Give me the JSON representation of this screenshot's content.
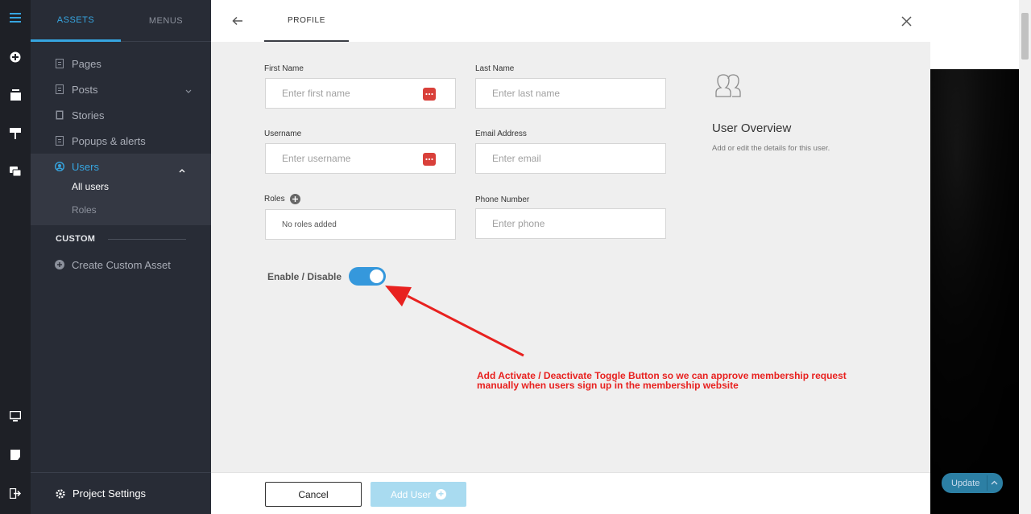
{
  "sidebar": {
    "tabs": [
      {
        "label": "ASSETS"
      },
      {
        "label": "MENUS"
      }
    ],
    "items": [
      {
        "label": "Pages"
      },
      {
        "label": "Posts"
      },
      {
        "label": "Stories"
      },
      {
        "label": "Popups & alerts"
      },
      {
        "label": "Users"
      }
    ],
    "users_sub": [
      "All users",
      "Roles"
    ],
    "custom_heading": "CUSTOM",
    "create_custom": "Create Custom Asset",
    "project_settings": "Project Settings"
  },
  "panel": {
    "tab_label": "PROFILE",
    "fields": {
      "first_name": {
        "label": "First Name",
        "placeholder": "Enter first name"
      },
      "last_name": {
        "label": "Last Name",
        "placeholder": "Enter last name"
      },
      "username": {
        "label": "Username",
        "placeholder": "Enter username"
      },
      "email": {
        "label": "Email Address",
        "placeholder": "Enter email"
      },
      "roles": {
        "label": "Roles",
        "value": "No roles added"
      },
      "phone": {
        "label": "Phone Number",
        "placeholder": "Enter phone"
      }
    },
    "overview": {
      "title": "User Overview",
      "subtitle": "Add or edit the details for this user."
    },
    "toggle": {
      "label": "Enable / Disable",
      "enabled": true
    },
    "annotation": "Add Activate / Deactivate Toggle Button so we can approve membership request manually when users sign up in the membership website",
    "footer": {
      "cancel_label": "Cancel",
      "add_user_label": "Add User"
    }
  },
  "preview": {
    "update_label": "Update"
  },
  "colors": {
    "accent": "#36a5e0",
    "toggle": "#3598dc",
    "annotation": "#e8211f",
    "password_badge": "#d9403a"
  }
}
